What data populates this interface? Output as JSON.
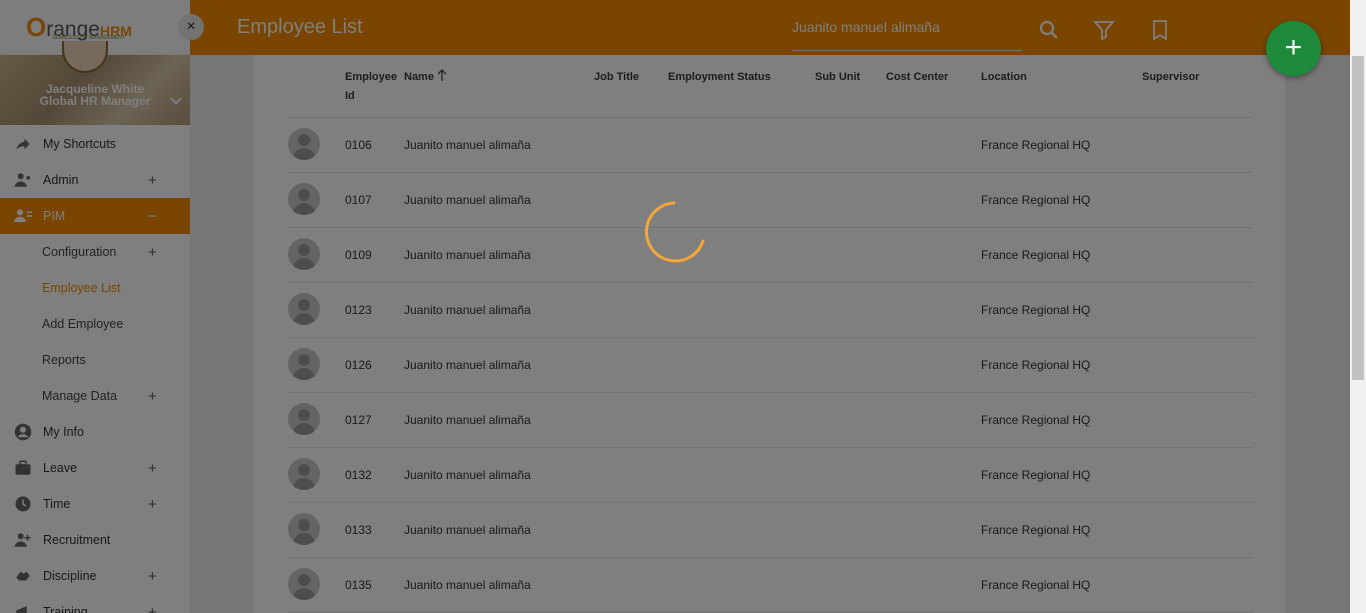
{
  "app": {
    "logo_prefix": "O",
    "logo_range": "range",
    "logo_hrm": "HRM",
    "logo_tagline": "SEAMLESS HR MANAGEMENT"
  },
  "profile": {
    "name": "Jacqueline White",
    "role": "Global HR Manager"
  },
  "sidebar": {
    "close_label": "×",
    "items": [
      {
        "label": "My Shortcuts",
        "icon": "share-arrow-icon",
        "expandable": false
      },
      {
        "label": "Admin",
        "icon": "admin-user-icon",
        "expandable": true,
        "toggle": "+"
      },
      {
        "label": "PIM",
        "icon": "pim-card-icon",
        "expandable": true,
        "toggle": "−",
        "active": true
      },
      {
        "label": "My Info",
        "icon": "account-circle-icon",
        "expandable": false
      },
      {
        "label": "Leave",
        "icon": "briefcase-icon",
        "expandable": true,
        "toggle": "+"
      },
      {
        "label": "Time",
        "icon": "clock-icon",
        "expandable": true,
        "toggle": "+"
      },
      {
        "label": "Recruitment",
        "icon": "recruitment-icon",
        "expandable": false
      },
      {
        "label": "Discipline",
        "icon": "discipline-icon",
        "expandable": true,
        "toggle": "+"
      },
      {
        "label": "Training",
        "icon": "training-icon",
        "expandable": true,
        "toggle": "+"
      }
    ],
    "pim_sub": [
      {
        "label": "Configuration",
        "toggle": "+"
      },
      {
        "label": "Employee List",
        "current": true
      },
      {
        "label": "Add Employee"
      },
      {
        "label": "Reports"
      },
      {
        "label": "Manage Data",
        "toggle": "+"
      }
    ]
  },
  "header": {
    "title": "Employee List",
    "search_value": "Juanito manuel alimaña",
    "icons": [
      "search-icon",
      "filter-icon",
      "bookmark-icon"
    ]
  },
  "fab_label": "+",
  "table": {
    "columns": [
      "Employee Id",
      "Name",
      "Job Title",
      "Employment Status",
      "Sub Unit",
      "Cost Center",
      "Location",
      "Supervisor"
    ],
    "col_employee_id_1": "Employee",
    "col_employee_id_2": "Id",
    "sorted_column": "Name",
    "sort_direction": "ascending",
    "rows": [
      {
        "id": "0106",
        "name": "Juanito manuel alimaña",
        "location": "France Regional HQ"
      },
      {
        "id": "0107",
        "name": "Juanito manuel alimaña",
        "location": "France Regional HQ"
      },
      {
        "id": "0109",
        "name": "Juanito manuel alimaña",
        "location": "France Regional HQ"
      },
      {
        "id": "0123",
        "name": "Juanito manuel alimaña",
        "location": "France Regional HQ"
      },
      {
        "id": "0126",
        "name": "Juanito manuel alimaña",
        "location": "France Regional HQ"
      },
      {
        "id": "0127",
        "name": "Juanito manuel alimaña",
        "location": "France Regional HQ"
      },
      {
        "id": "0132",
        "name": "Juanito manuel alimaña",
        "location": "France Regional HQ"
      },
      {
        "id": "0133",
        "name": "Juanito manuel alimaña",
        "location": "France Regional HQ"
      },
      {
        "id": "0135",
        "name": "Juanito manuel alimaña",
        "location": "France Regional HQ"
      }
    ]
  },
  "colors": {
    "accent": "#f28b00",
    "fab": "#1c8a3a",
    "spinner": "#f4a63a"
  },
  "state": {
    "loading": true
  }
}
